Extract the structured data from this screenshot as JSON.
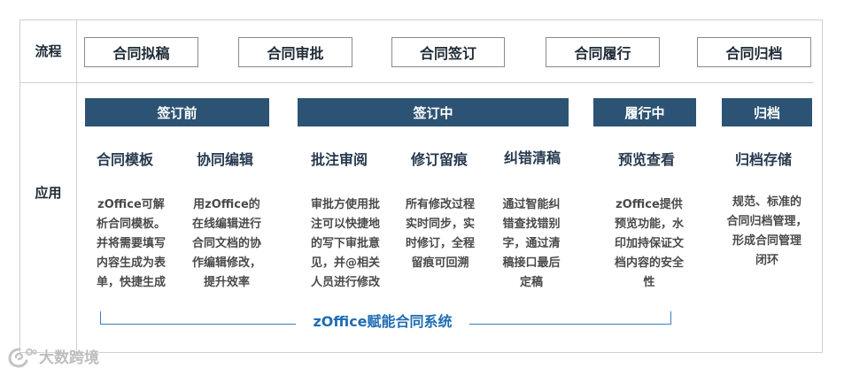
{
  "row_labels": {
    "process": "流程",
    "application": "应用"
  },
  "process_steps": [
    {
      "label": "合同拟稿"
    },
    {
      "label": "合同审批"
    },
    {
      "label": "合同签订"
    },
    {
      "label": "合同履行"
    },
    {
      "label": "合同归档"
    }
  ],
  "phases": [
    {
      "label": "签订前"
    },
    {
      "label": "签订中"
    },
    {
      "label": "履行中"
    },
    {
      "label": "归档"
    }
  ],
  "features": [
    {
      "title": "合同模板",
      "desc": "zOffice可解\n析合同模板。\n并将需要填写\n内容生成为表\n单，快捷生成"
    },
    {
      "title": "协同编辑",
      "desc": "用zOffice的\n在线编辑进行\n合同文档的协\n作编辑修改，\n提升效率"
    },
    {
      "title": "批注审阅",
      "desc": "审批方使用批\n注可以快捷地\n的写下审批意\n见，并@相关\n人员进行修改"
    },
    {
      "title": "修订留痕",
      "desc": "所有修改过程\n实时同步，实\n时修订，全程\n留痕可回溯"
    },
    {
      "title": "纠错清稿",
      "desc": "通过智能纠\n错查找错别\n字，通过清\n稿接口最后\n定稿"
    },
    {
      "title": "预览查看",
      "desc": "zOffice提供\n预览功能，水\n印加持保证文\n档内容的安全\n性"
    },
    {
      "title": "归档存储",
      "desc": "规范、标准的\n合同归档管理，\n形成合同管理\n闭环"
    }
  ],
  "footer": {
    "label": "zOffice赋能合同系统"
  },
  "watermark": {
    "text": "大数跨境",
    "icon": "watermark-logo-icon"
  },
  "colors": {
    "phase_bar": "#2d5374",
    "accent_blue": "#1f6db4",
    "bracket_line": "#3b7dc0",
    "title_text": "#263a4e",
    "body_text": "#4a4a4a",
    "frame": "#cfcfcf",
    "box_border": "#8a8a8a",
    "watermark": "#bdbdbd"
  }
}
